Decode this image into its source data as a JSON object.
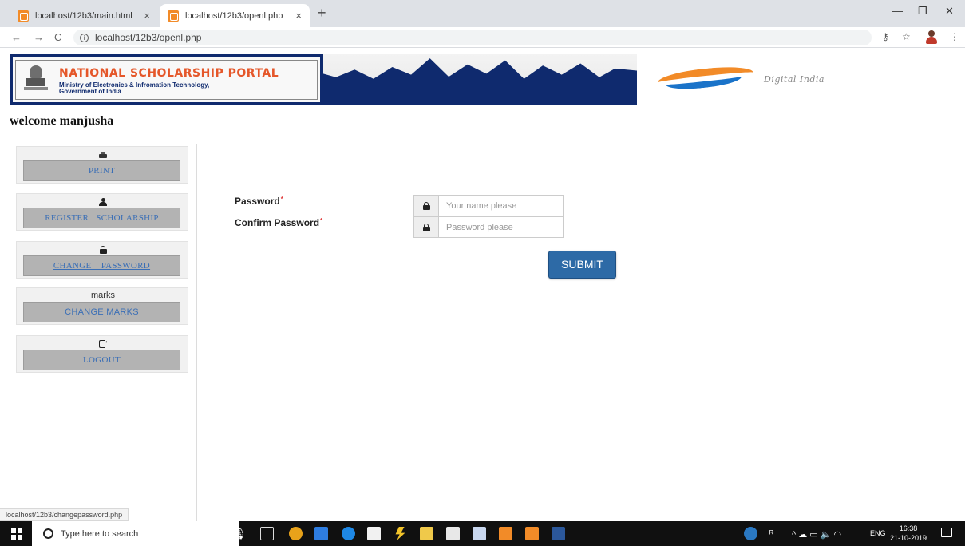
{
  "browser": {
    "tabs": [
      {
        "title": "localhost/12b3/main.html",
        "close": "×"
      },
      {
        "title": "localhost/12b3/openl.php",
        "close": "×"
      }
    ],
    "new_tab": "+",
    "url": "localhost/12b3/openl.php",
    "window_controls": {
      "minimize": "—",
      "maximize": "❐",
      "close": "✕"
    }
  },
  "header": {
    "portal_title": "NATIONAL SCHOLARSHIP PORTAL",
    "ministry": "Ministry of Electronics & Infromation Technology,",
    "government": "Government of India",
    "digital_india": "Digital India"
  },
  "welcome": "welcome manjusha",
  "sidebar": {
    "items": [
      {
        "label": "PRINT",
        "icon": "print-icon"
      },
      {
        "label": "REGISTER   SCHOLARSHIP",
        "icon": "user-icon"
      },
      {
        "label": "CHANGE    PASSWORD",
        "icon": "lock-icon"
      },
      {
        "label": "CHANGE MARKS",
        "caption": "marks"
      },
      {
        "label": "LOGOUT",
        "icon": "logout-icon"
      }
    ]
  },
  "form": {
    "password_label": "Password",
    "confirm_label": "Confirm Password",
    "required_mark": "*",
    "password_placeholder": "Your name please",
    "confirm_placeholder": "Password please",
    "submit_label": "SUBMIT"
  },
  "status_url": "localhost/12b3/changepassword.php",
  "taskbar": {
    "search_placeholder": "Type here to search",
    "language": "ENG",
    "time": "16:38",
    "date": "21-10-2019"
  },
  "colors": {
    "portal_navy": "#0f2a6e",
    "portal_orange": "#e5572a",
    "submit_blue": "#2d6aa6",
    "sidebar_link": "#3b6fb6"
  }
}
